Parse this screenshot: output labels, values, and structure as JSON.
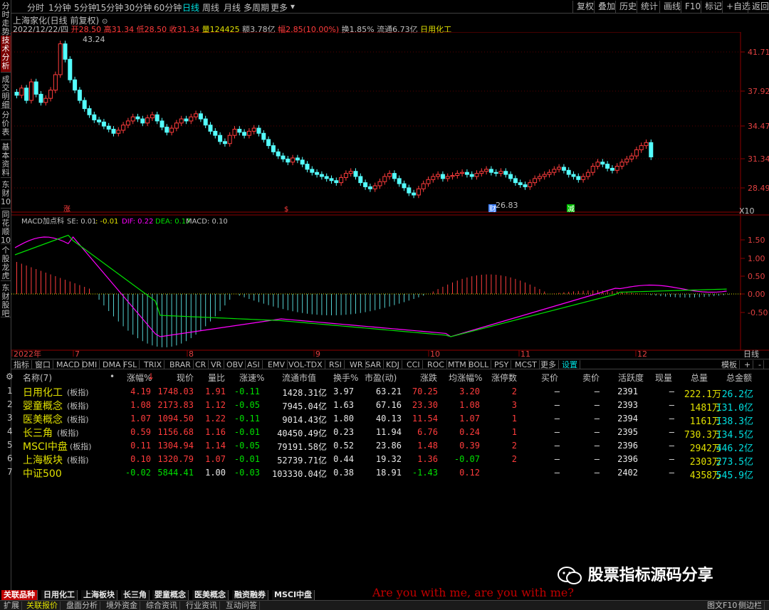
{
  "left_sidebar": [
    "分时走势",
    "技术分析",
    "成交明细",
    "分价表",
    "基本资料",
    "东财10",
    "同花顺10",
    "个股龙虎",
    "东财股吧"
  ],
  "top_bar": {
    "periods": [
      "分时",
      "1分钟",
      "5分钟",
      "15分钟",
      "30分钟",
      "60分钟",
      "日线",
      "周线",
      "月线",
      "多周期",
      "更多"
    ],
    "selected": "日线",
    "right_buttons": [
      "复权",
      "叠加",
      "历史",
      "统计",
      "画线",
      "F10",
      "标记",
      "+自选",
      "返回"
    ]
  },
  "chart_header": {
    "title": "上海家化(日线 前复权)",
    "date": "2022/12/22/四",
    "open_label": "开",
    "open": "28.50",
    "high_label": "高",
    "high": "31.34",
    "low_label": "低",
    "low": "28.50",
    "close_label": "收",
    "close": "31.34",
    "vol_label": "量",
    "vol": "124425",
    "amt_label": "额",
    "amt": "3.78亿",
    "chg_label": "幅",
    "chg": "2.85(10.00%)",
    "turn_label": "换",
    "turn": "1.85%",
    "float_label": "流通",
    "float_val": "6.73亿",
    "sector": "日用化工"
  },
  "price_axis": [
    "41.71",
    "37.92",
    "34.47",
    "31.34",
    "28.49"
  ],
  "price_annotations": {
    "high": "43.24",
    "low": "26.83"
  },
  "markers": [
    "涨",
    "$",
    "财",
    "减"
  ],
  "scale_label": "X10",
  "macd": {
    "label": "MACD加点科",
    "se": "SE: 0.01",
    "v2": ": -0.01",
    "dif": "DIF: 0.22",
    "dea": "DEA: 0.17",
    "macd": "MACD: 0.10",
    "axis": [
      "1.50",
      "1.00",
      "0.50",
      "0.00",
      "-0.50"
    ]
  },
  "date_axis": {
    "labels": [
      "2022年",
      "7",
      "8",
      "9",
      "10",
      "11",
      "12"
    ],
    "right_label": "日线"
  },
  "indicator_tabs": [
    "指标",
    "窗口",
    "MACD",
    "DMI",
    "DMA",
    "FSL",
    "TRIX",
    "BRAR",
    "CR",
    "VR",
    "OBV",
    "ASI",
    "EMV",
    "VOL-TDX",
    "RSI",
    "WR",
    "SAR",
    "KDJ",
    "CCI",
    "ROC",
    "MTM",
    "BOLL",
    "PSY",
    "MCST",
    "更多",
    "设置"
  ],
  "indicator_right": [
    "模板",
    "+",
    "-"
  ],
  "table": {
    "headers": [
      "名称(7)",
      "涨幅%",
      "现价",
      "量比",
      "涨速%",
      "流通市值",
      "换手%",
      "市盈(动)",
      "涨跌",
      "均涨幅%",
      "涨停数",
      "买价",
      "卖价",
      "活跃度",
      "现量",
      "总量",
      "总金额"
    ],
    "rows": [
      {
        "idx": "1",
        "name": "日用化工",
        "tag": "(板指)",
        "chg": "4.19",
        "price": "1748.03",
        "vr": "1.91",
        "spd": "-0.11",
        "mcap": "1428.31亿",
        "turn": "3.97",
        "pe": "63.21",
        "diff": "70.25",
        "avg": "3.20",
        "limit": "2",
        "buy": "—",
        "sell": "—",
        "act": "2391",
        "cur": "—",
        "vol": "222.1万",
        "amt": "26.2亿"
      },
      {
        "idx": "2",
        "name": "婴童概念",
        "tag": "(板指)",
        "chg": "1.08",
        "price": "2173.83",
        "vr": "1.12",
        "spd": "-0.05",
        "mcap": "7945.04亿",
        "turn": "1.63",
        "pe": "67.16",
        "diff": "23.30",
        "avg": "1.08",
        "limit": "3",
        "buy": "—",
        "sell": "—",
        "act": "2393",
        "cur": "—",
        "vol": "1481万",
        "amt": "131.0亿"
      },
      {
        "idx": "3",
        "name": "医美概念",
        "tag": "(板指)",
        "chg": "1.07",
        "price": "1094.50",
        "vr": "1.22",
        "spd": "-0.11",
        "mcap": "9014.43亿",
        "turn": "1.80",
        "pe": "40.13",
        "diff": "11.54",
        "avg": "1.07",
        "limit": "1",
        "buy": "—",
        "sell": "—",
        "act": "2394",
        "cur": "—",
        "vol": "1161万",
        "amt": "138.3亿"
      },
      {
        "idx": "4",
        "name": "长三角",
        "tag": "(板指)",
        "chg": "0.59",
        "price": "1156.68",
        "vr": "1.16",
        "spd": "-0.01",
        "mcap": "40450.49亿",
        "turn": "0.23",
        "pe": "11.94",
        "diff": "6.76",
        "avg": "0.24",
        "limit": "1",
        "buy": "—",
        "sell": "—",
        "act": "2395",
        "cur": "—",
        "vol": "730.3万",
        "amt": "134.5亿"
      },
      {
        "idx": "5",
        "name": "MSCI中盘",
        "tag": "(板指)",
        "chg": "0.11",
        "price": "1304.94",
        "vr": "1.14",
        "spd": "-0.05",
        "mcap": "79191.58亿",
        "turn": "0.52",
        "pe": "23.86",
        "diff": "1.48",
        "avg": "0.39",
        "limit": "2",
        "buy": "—",
        "sell": "—",
        "act": "2396",
        "cur": "—",
        "vol": "2942万",
        "amt": "446.2亿"
      },
      {
        "idx": "6",
        "name": "上海板块",
        "tag": "(板指)",
        "chg": "0.10",
        "price": "1320.79",
        "vr": "1.07",
        "spd": "-0.01",
        "mcap": "52739.71亿",
        "turn": "0.44",
        "pe": "19.32",
        "diff": "1.36",
        "avg": "-0.07",
        "limit": "2",
        "buy": "—",
        "sell": "—",
        "act": "2396",
        "cur": "—",
        "vol": "2303万",
        "amt": "273.5亿"
      },
      {
        "idx": "7",
        "name": "中证500",
        "tag": "",
        "chg": "-0.02",
        "price": "5844.41",
        "vr": "1.00",
        "spd": "-0.03",
        "mcap": "103330.04亿",
        "turn": "0.38",
        "pe": "18.91",
        "diff": "-1.43",
        "avg": "0.12",
        "limit": "",
        "buy": "—",
        "sell": "—",
        "act": "2402",
        "cur": "—",
        "vol": "4358万",
        "amt": "545.9亿"
      }
    ]
  },
  "bottom_tabs": [
    "关联品种",
    "日用化工",
    "上海板块",
    "长三角",
    "婴童概念",
    "医美概念",
    "融资融券",
    "MSCI中盘"
  ],
  "status_bar": [
    "扩展",
    "关联报价",
    "盘面分析",
    "境外资金",
    "综合资讯",
    "行业资讯",
    "互动问答"
  ],
  "status_right": [
    "图文F10",
    "侧边栏"
  ],
  "watermark": "股票指标源码分享",
  "lyric": "Are you with me, are you with me?",
  "colors": {
    "up": "#ff3c3c",
    "down": "#00e0e0",
    "dif": "#ff00ff",
    "dea": "#00e000"
  }
}
